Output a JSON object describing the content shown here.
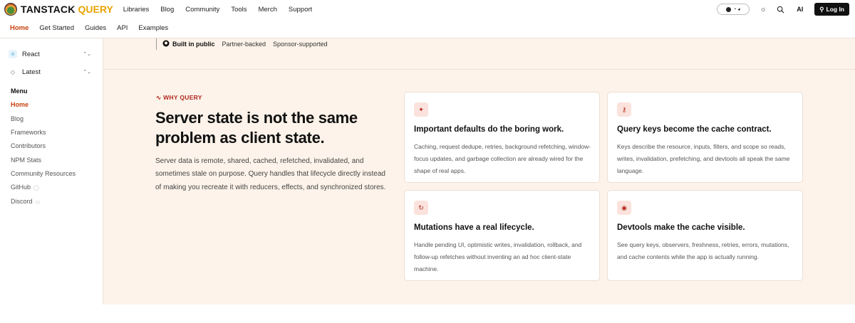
{
  "brand": {
    "name": "TANSTACK",
    "product": "QUERY"
  },
  "topnav": [
    "Libraries",
    "Blog",
    "Community",
    "Tools",
    "Merch",
    "Support"
  ],
  "topright": {
    "stars": "",
    "ai_label": "AI",
    "login_label": "Log In"
  },
  "subnav": [
    "Home",
    "Get Started",
    "Guides",
    "API",
    "Examples"
  ],
  "sidebar": {
    "framework": "React",
    "version": "Latest",
    "menu_title": "Menu",
    "items": [
      "Home",
      "Blog",
      "Frameworks",
      "Contributors",
      "NPM Stats",
      "Community Resources",
      "GitHub",
      "Discord"
    ],
    "active_index": 0
  },
  "badges": [
    "Built in public",
    "Partner-backed",
    "Sponsor-supported"
  ],
  "hero": {
    "eyebrow": "WHY QUERY",
    "headline": "Server state is not the same problem as client state.",
    "lead": "Server data is remote, shared, cached, refetched, invalidated, and sometimes stale on purpose. Query handles that lifecycle directly instead of making you recreate it with reducers, effects, and synchronized stores."
  },
  "cards": [
    {
      "icon": "sparkle-icon",
      "title": "Important defaults do the boring work.",
      "body": "Caching, request dedupe, retries, background refetching, window-focus updates, and garbage collection are already wired for the shape of real apps."
    },
    {
      "icon": "key-icon",
      "title": "Query keys become the cache contract.",
      "body": "Keys describe the resource, inputs, filters, and scope so reads, writes, invalidation, prefetching, and devtools all speak the same language."
    },
    {
      "icon": "refresh-icon",
      "title": "Mutations have a real lifecycle.",
      "body": "Handle pending UI, optimistic writes, invalidation, rollback, and follow-up refetches without inventing an ad hoc client-state machine."
    },
    {
      "icon": "eye-icon",
      "title": "Devtools make the cache visible.",
      "body": "See query keys, observers, freshness, retries, errors, mutations, and cache contents while the app is actually running."
    }
  ],
  "colors": {
    "accent": "#c9410f",
    "eyebrow": "#b3261e",
    "brand_accent": "#e8a400",
    "main_bg": "#fdf3ea"
  }
}
